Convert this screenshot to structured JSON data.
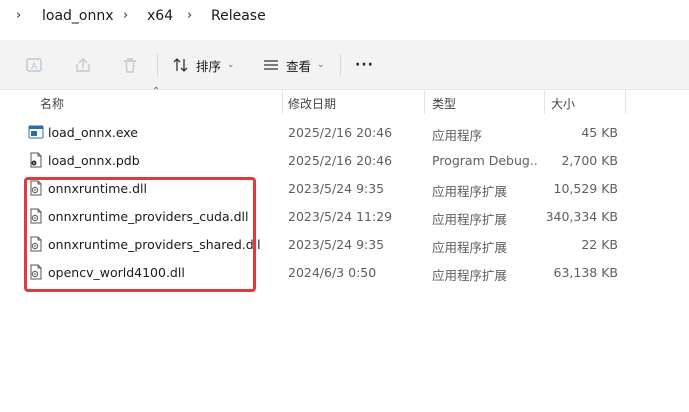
{
  "breadcrumb": {
    "items": [
      "load_onnx",
      "x64",
      "Release"
    ]
  },
  "toolbar": {
    "sort_label": "排序",
    "view_label": "查看",
    "more_label": "···"
  },
  "columns": {
    "name": "名称",
    "modified": "修改日期",
    "type": "类型",
    "size": "大小"
  },
  "files": [
    {
      "name": "load_onnx.exe",
      "modified": "2025/2/16 20:46",
      "type": "应用程序",
      "size": "45 KB",
      "icon": "exe-icon"
    },
    {
      "name": "load_onnx.pdb",
      "modified": "2025/2/16 20:46",
      "type": "Program Debug...",
      "size": "2,700 KB",
      "icon": "pdb-icon"
    },
    {
      "name": "onnxruntime.dll",
      "modified": "2023/5/24 9:35",
      "type": "应用程序扩展",
      "size": "10,529 KB",
      "icon": "dll-icon"
    },
    {
      "name": "onnxruntime_providers_cuda.dll",
      "modified": "2023/5/24 11:29",
      "type": "应用程序扩展",
      "size": "340,334 KB",
      "icon": "dll-icon"
    },
    {
      "name": "onnxruntime_providers_shared.dll",
      "modified": "2023/5/24 9:35",
      "type": "应用程序扩展",
      "size": "22 KB",
      "icon": "dll-icon"
    },
    {
      "name": "opencv_world4100.dll",
      "modified": "2024/6/3 0:50",
      "type": "应用程序扩展",
      "size": "63,138 KB",
      "icon": "dll-icon"
    }
  ],
  "colors": {
    "highlight": "#e0393e",
    "toolbar_bg": "#f3f3f3"
  }
}
